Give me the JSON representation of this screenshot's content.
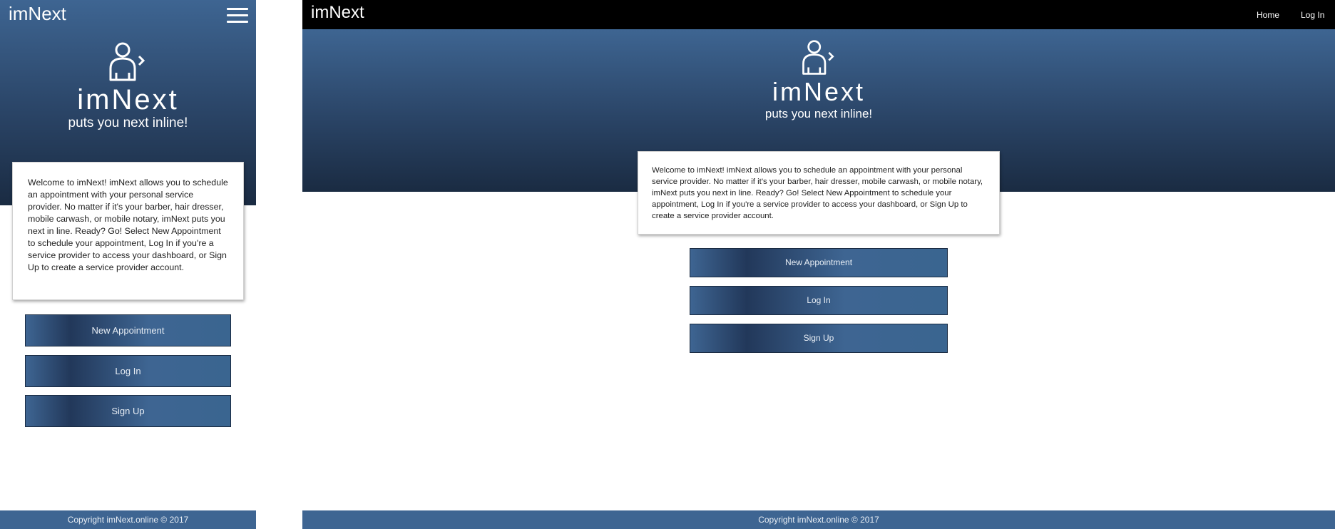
{
  "mobile": {
    "brand": "imNext",
    "menu_icon": "hamburger-menu-icon",
    "hero": {
      "logo_icon": "user-next-icon",
      "title": "imNext",
      "tagline": "puts you next inline!"
    },
    "welcome": "Welcome to imNext! imNext allows you to schedule an appointment with your personal service provider. No matter if it's your barber, hair dresser, mobile carwash, or mobile notary, imNext puts you next in line. Ready? Go! Select New Appointment to schedule your appointment, Log In if you're a service provider to access your dashboard, or Sign Up to create a service provider account.",
    "buttons": {
      "new_appointment": "New Appointment",
      "log_in": "Log In",
      "sign_up": "Sign Up"
    },
    "footer": "Copyright imNext.online © 2017"
  },
  "desktop": {
    "brand": "imNext",
    "nav": {
      "home": "Home",
      "log_in": "Log In"
    },
    "hero": {
      "logo_icon": "user-next-icon",
      "title": "imNext",
      "tagline": "puts you next inline!"
    },
    "welcome": "Welcome to imNext! imNext allows you to schedule an appointment with your personal service provider. No matter if it's your barber, hair dresser, mobile carwash, or mobile notary, imNext puts you next in line. Ready? Go! Select New Appointment to schedule your appointment, Log In if you're a service provider to access your dashboard, or Sign Up to create a service provider account.",
    "buttons": {
      "new_appointment": "New Appointment",
      "log_in": "Log In",
      "sign_up": "Sign Up"
    },
    "footer": "Copyright imNext.online © 2017"
  },
  "colors": {
    "brand_blue": "#3e6592",
    "hero_dark": "#1a2b42",
    "nav_bg": "#000000"
  }
}
